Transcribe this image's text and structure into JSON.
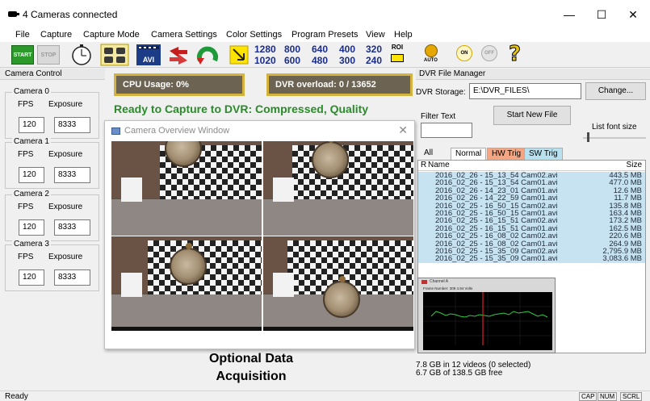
{
  "window": {
    "title": "4 Cameras connected",
    "controls": [
      "—",
      "☐",
      "✕"
    ]
  },
  "menu": [
    "File",
    "Capture",
    "Capture Mode",
    "Camera Settings",
    "Color Settings",
    "Program Presets",
    "View",
    "Help"
  ],
  "toolbar": {
    "start": "START",
    "stop": "STOP",
    "avi": "AVI",
    "resolutions": [
      [
        "1280",
        "800"
      ],
      [
        "640",
        "400"
      ],
      [
        "320",
        "ROI"
      ]
    ],
    "resolutions_row2": [
      [
        "1020",
        "600"
      ],
      [
        "480",
        "300"
      ],
      [
        "240",
        ""
      ]
    ],
    "roi": "ROI",
    "auto": "AUTO",
    "on": "ON",
    "off": "OFF",
    "help": "?"
  },
  "camera_control": {
    "header": "Camera Control",
    "fps_label": "FPS",
    "exposure_label": "Exposure",
    "cameras": [
      {
        "name": "Camera 0",
        "fps": "120",
        "exposure": "8333"
      },
      {
        "name": "Camera 1",
        "fps": "120",
        "exposure": "8333"
      },
      {
        "name": "Camera 2",
        "fps": "120",
        "exposure": "8333"
      },
      {
        "name": "Camera 3",
        "fps": "120",
        "exposure": "8333"
      }
    ]
  },
  "main": {
    "cpu_usage": "CPU Usage: 0%",
    "dvr_overload": "DVR overload: 0 / 13652",
    "ready_text": "Ready to Capture to DVR:  Compressed, Quality",
    "overview_title": "Camera Overview Window",
    "overview_close": "✕",
    "caption_line1": "Optional Data",
    "caption_line2": "Acquisition"
  },
  "dvr": {
    "header": "DVR File Manager",
    "storage_label": "DVR Storage:",
    "storage_path": "E:\\DVR_FILES\\",
    "change_button": "Change...",
    "filter_label": "Filter Text",
    "filter_value": "",
    "start_new_file": "Start New File",
    "list_font_size": "List font size",
    "tabs": [
      "All",
      "Normal",
      "HW Trig",
      "SW Trig"
    ],
    "columns": {
      "r": "R",
      "name": "Name",
      "size": "Size"
    },
    "files": [
      {
        "name": "2016_02_26 - 15_13_54 Cam02.avi",
        "size": "443.5 MB"
      },
      {
        "name": "2016_02_26 - 15_13_54 Cam01.avi",
        "size": "477.0 MB"
      },
      {
        "name": "2016_02_26 - 14_23_01 Cam01.avi",
        "size": "12.6 MB"
      },
      {
        "name": "2016_02_26 - 14_22_59 Cam01.avi",
        "size": "11.7 MB"
      },
      {
        "name": "2016_02_25 - 16_50_15 Cam02.avi",
        "size": "135.8 MB"
      },
      {
        "name": "2016_02_25 - 16_50_15 Cam01.avi",
        "size": "163.4 MB"
      },
      {
        "name": "2016_02_25 - 16_15_51 Cam02.avi",
        "size": "173.2 MB"
      },
      {
        "name": "2016_02_25 - 16_15_51 Cam01.avi",
        "size": "162.5 MB"
      },
      {
        "name": "2016_02_25 - 16_08_02 Cam02.avi",
        "size": "220.6 MB"
      },
      {
        "name": "2016_02_25 - 16_08_02 Cam01.avi",
        "size": "264.9 MB"
      },
      {
        "name": "2016_02_25 - 15_35_09 Cam02.avi",
        "size": "2,795.9 MB"
      },
      {
        "name": "2016_02_25 - 15_35_09 Cam01.avi",
        "size": "3,083.6 MB"
      }
    ],
    "summary_line1": "7.8 GB in 12 videos (0 selected)",
    "summary_line2": "6.7 GB of 138.5 GB free",
    "graph_title": "Channel A",
    "graph_subtitle": "Frame Number: 309  4.94 Volts"
  },
  "status": {
    "text": "Ready",
    "indicators": [
      "CAP",
      "NUM",
      "SCRL"
    ]
  },
  "colors": {
    "start_green": "#2b9a2b",
    "ready_green": "#2a8b2a",
    "meter_bg": "#6c6352",
    "meter_border": "#d4b43f",
    "list_row_bg": "#c7e3f2",
    "hw_tab": "#f4a582",
    "sw_tab": "#b8e1f0",
    "graph_line": "#2ecc40",
    "graph_marker": "#e02020"
  }
}
